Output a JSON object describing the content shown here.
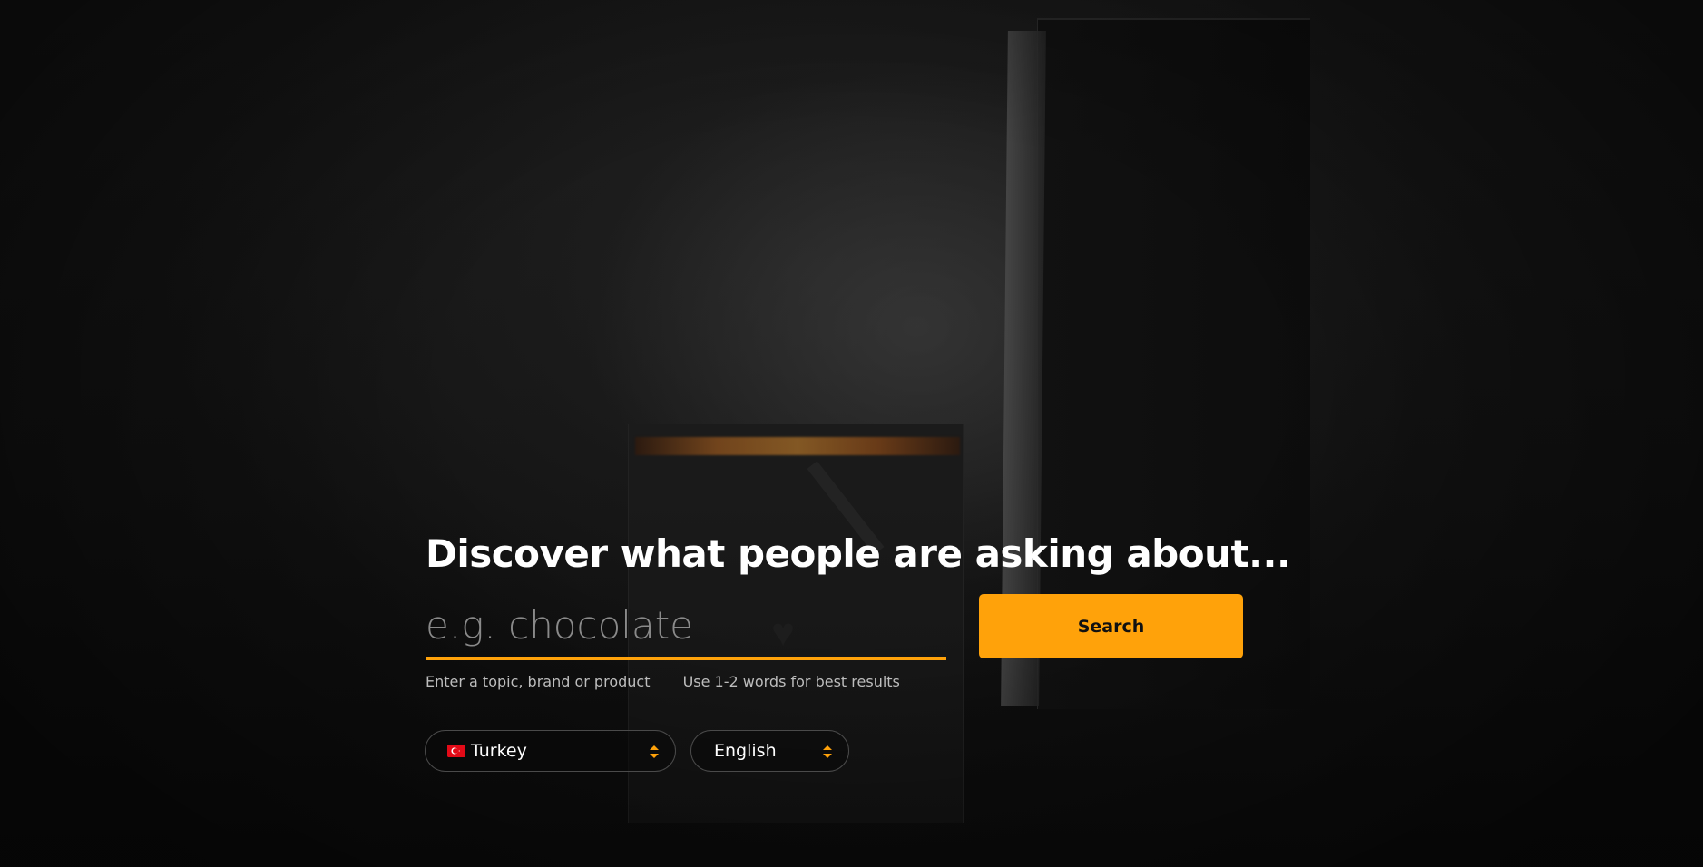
{
  "hero": {
    "headline": "Discover what people are asking about...",
    "search": {
      "placeholder": "e.g. chocolate",
      "value": "",
      "button_label": "Search"
    },
    "hints": [
      "Enter a topic, brand or product",
      "Use 1-2 words for best results"
    ],
    "country_select": {
      "flag_icon": "turkey-flag-icon",
      "selected": "Turkey"
    },
    "language_select": {
      "selected": "English"
    }
  },
  "colors": {
    "accent": "#ffa20a",
    "background": "#0e0e0e",
    "headline": "#ffffff",
    "hint_text": "#bdbdbd",
    "placeholder": "#8a8a8a"
  }
}
